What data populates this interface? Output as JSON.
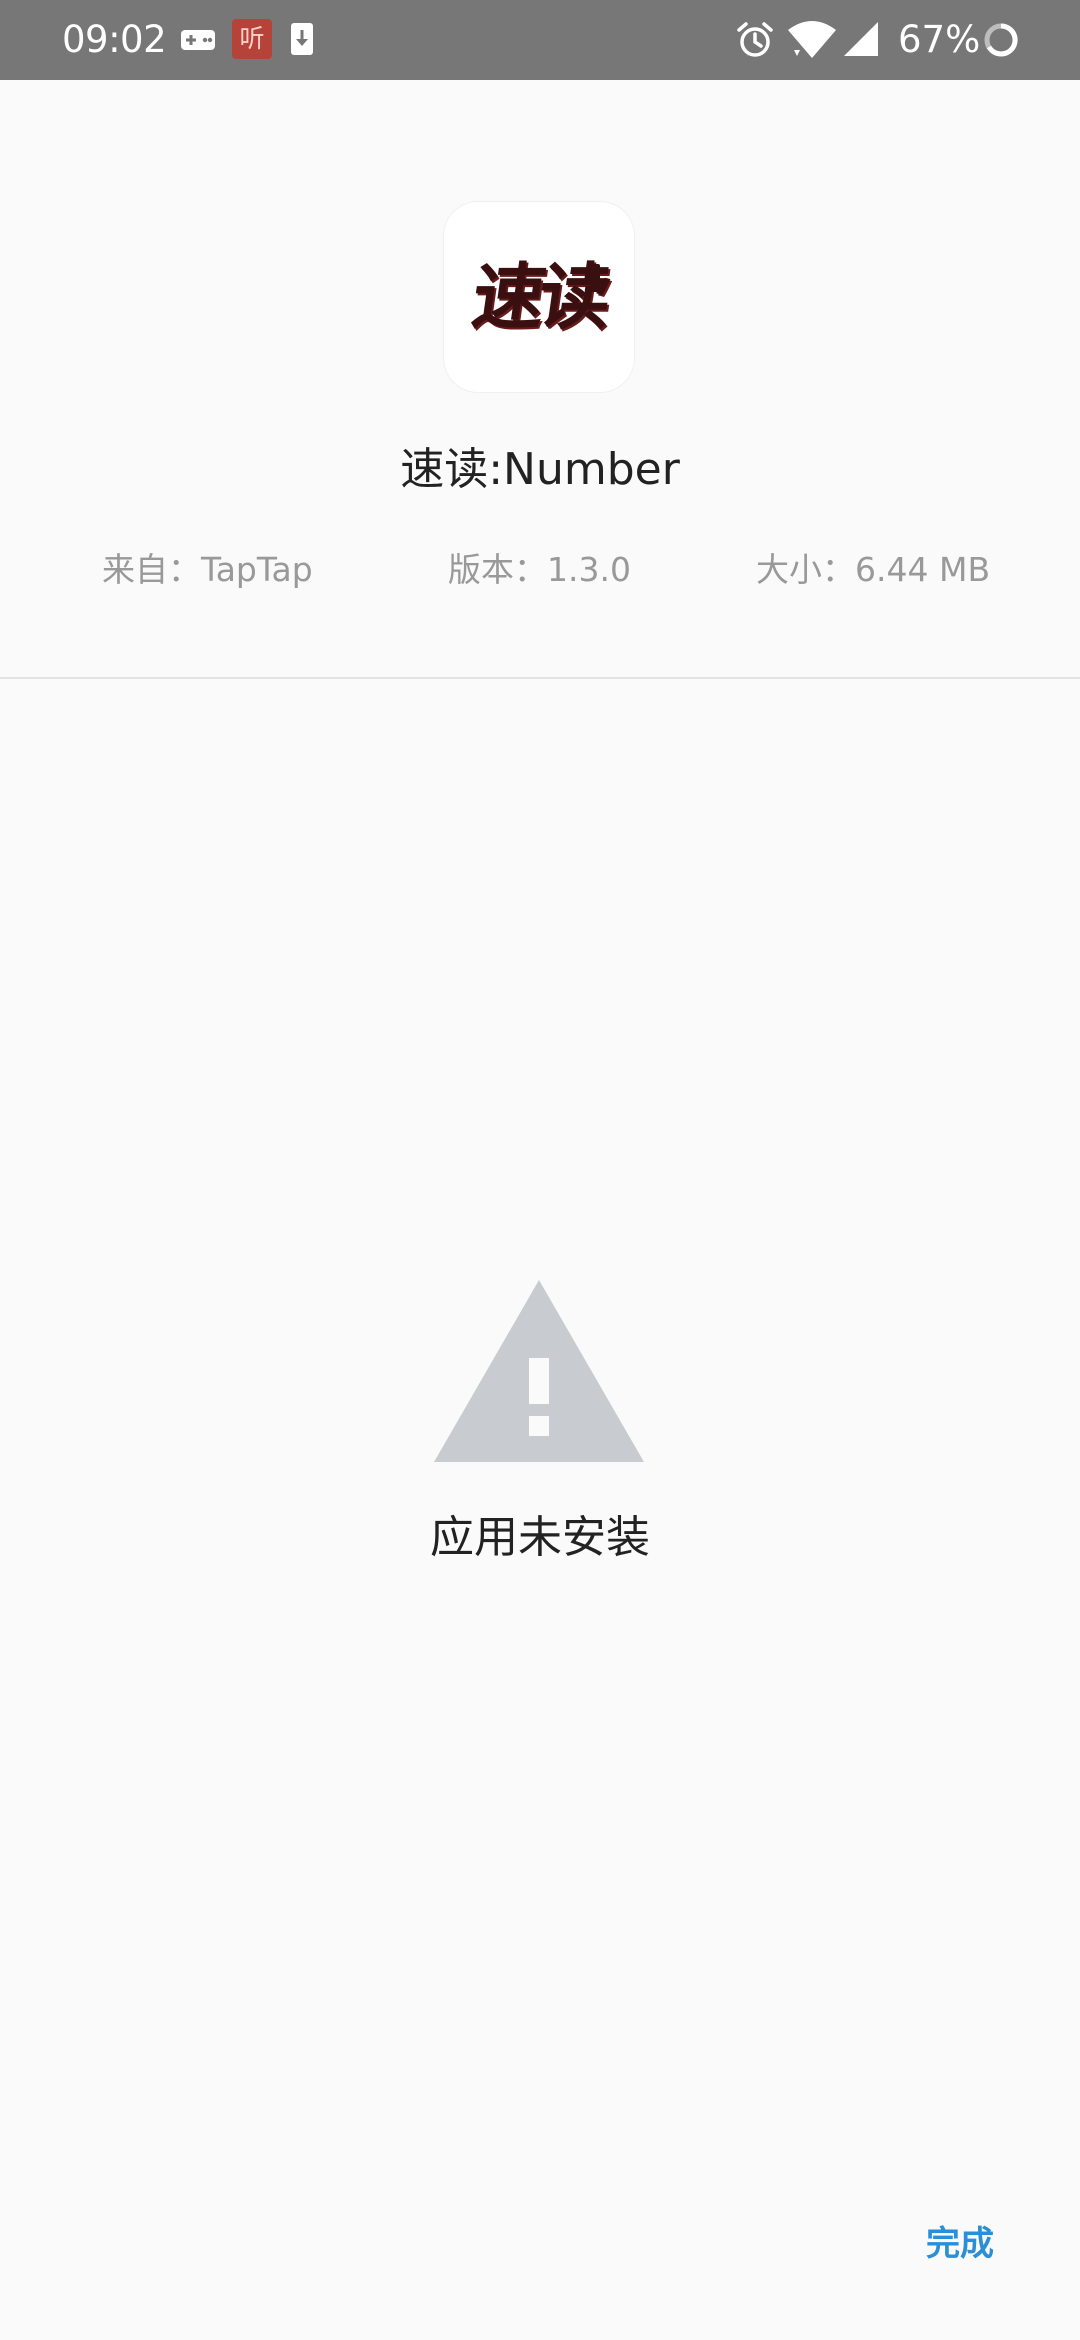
{
  "status_bar": {
    "time": "09:02",
    "listen_label": "听",
    "battery_percent": "67%",
    "icons": [
      "gamepad-icon",
      "listen-app-icon",
      "download-icon",
      "alarm-icon",
      "wifi-icon",
      "signal-icon",
      "battery-ring-icon"
    ]
  },
  "app": {
    "icon_text": "速读",
    "title": "速读:Number",
    "source": "来自：TapTap",
    "version": "版本：1.3.0",
    "size": "大小：6.44 MB"
  },
  "result": {
    "icon": "warning-icon",
    "message": "应用未安装"
  },
  "actions": {
    "done_label": "完成"
  },
  "colors": {
    "status_bar": "#777777",
    "background": "#fafafa",
    "accent": "#2a8fd6",
    "warning_icon": "#c8cbcf",
    "meta_text": "#999999"
  }
}
